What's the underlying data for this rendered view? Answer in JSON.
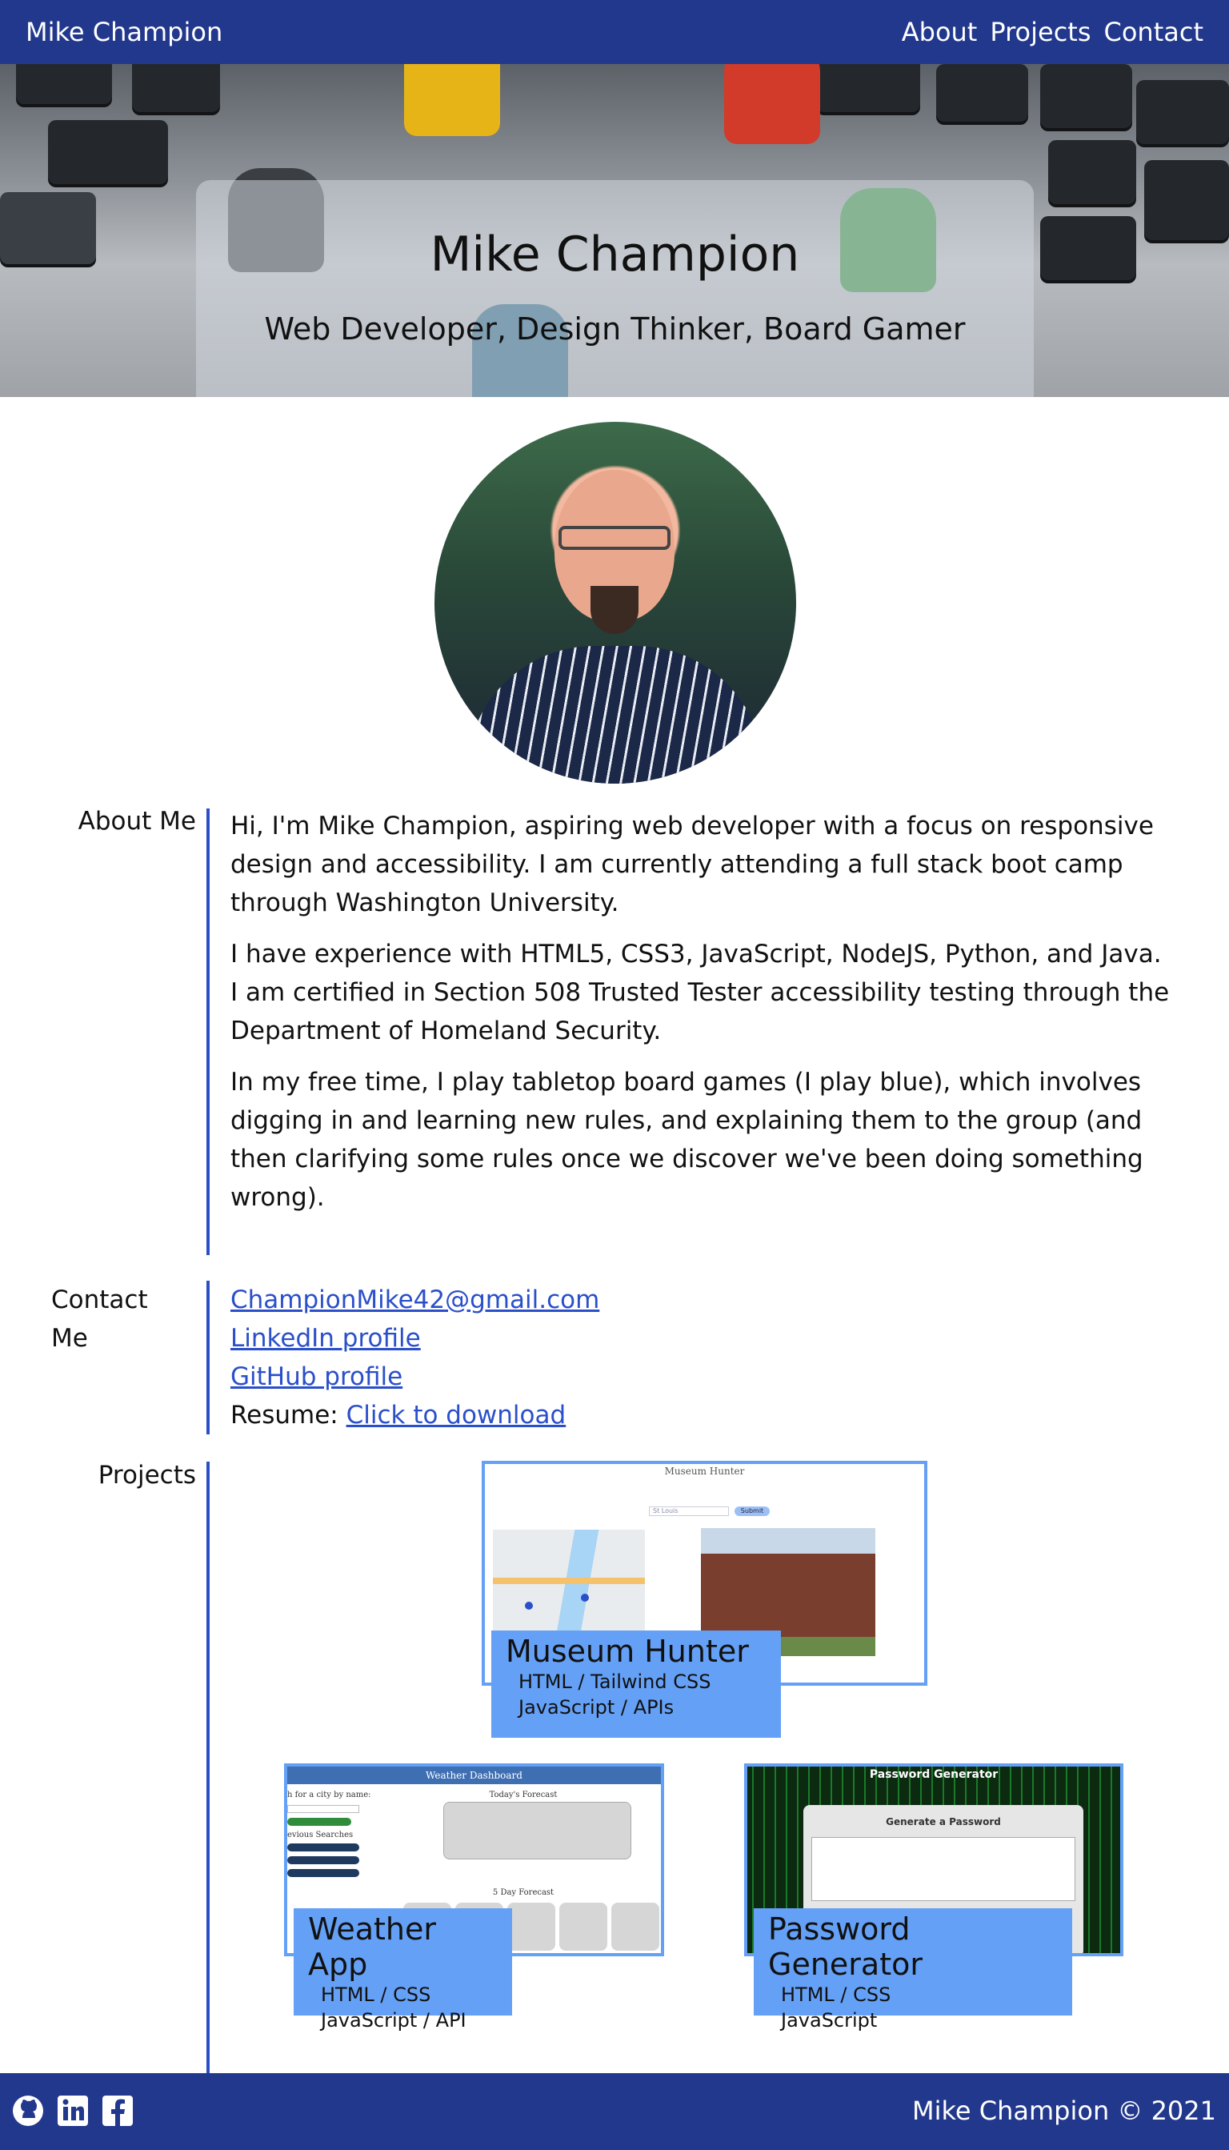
{
  "nav": {
    "brand": "Mike Champion",
    "links": [
      "About",
      "Projects",
      "Contact"
    ]
  },
  "hero": {
    "name": "Mike Champion",
    "tagline": "Web Developer, Design Thinker, Board Gamer"
  },
  "about": {
    "label": "About Me",
    "paragraphs": [
      "Hi, I'm Mike Champion, aspiring web developer with a focus on responsive design and accessibility. I am currently attending a full stack boot camp through Washington University.",
      "I have experience with HTML5, CSS3, JavaScript, NodeJS, Python, and Java.",
      "I am certified in Section 508 Trusted Tester accessibility testing through the Department of Homeland Security.",
      "In my free time, I play tabletop board games (I play blue), which involves digging in and learning new rules, and explaining them to the group (and then clarifying some rules once we discover we've been doing something wrong)."
    ]
  },
  "contact": {
    "label_line1": "Contact",
    "label_line2": "Me",
    "email": "ChampionMike42@gmail.com",
    "linkedin": "LinkedIn profile",
    "github": "GitHub profile",
    "resume_prefix": "Resume: ",
    "resume_link": "Click to download"
  },
  "projects": {
    "label": "Projects",
    "items": [
      {
        "title": "Museum Hunter",
        "tech1": "HTML / Tailwind CSS",
        "tech2": "JavaScript / APIs",
        "shot_title": "Museum Hunter",
        "shot_input": "St Louis",
        "shot_button": "Submit"
      },
      {
        "title": "Weather App",
        "tech1": "HTML / CSS",
        "tech2": "JavaScript / API",
        "shot_title": "Weather Dashboard",
        "shot_sub": "Today's Forecast",
        "shot_five": "5 Day Forecast",
        "shot_search": "h for a city by name:",
        "shot_prev": "evious Searches"
      },
      {
        "title": "Password Generator",
        "tech1": "HTML / CSS",
        "tech2": "JavaScript",
        "shot_title": "Password Generator",
        "shot_sub": "Generate a Password"
      }
    ]
  },
  "footer": {
    "copyright": "Mike Champion © 2021",
    "icons": [
      "github-icon",
      "linkedin-icon",
      "facebook-icon"
    ]
  },
  "colors": {
    "nav_bg": "#22388c",
    "accent": "#2a4fc9",
    "project_label_bg": "#64a0f5"
  }
}
